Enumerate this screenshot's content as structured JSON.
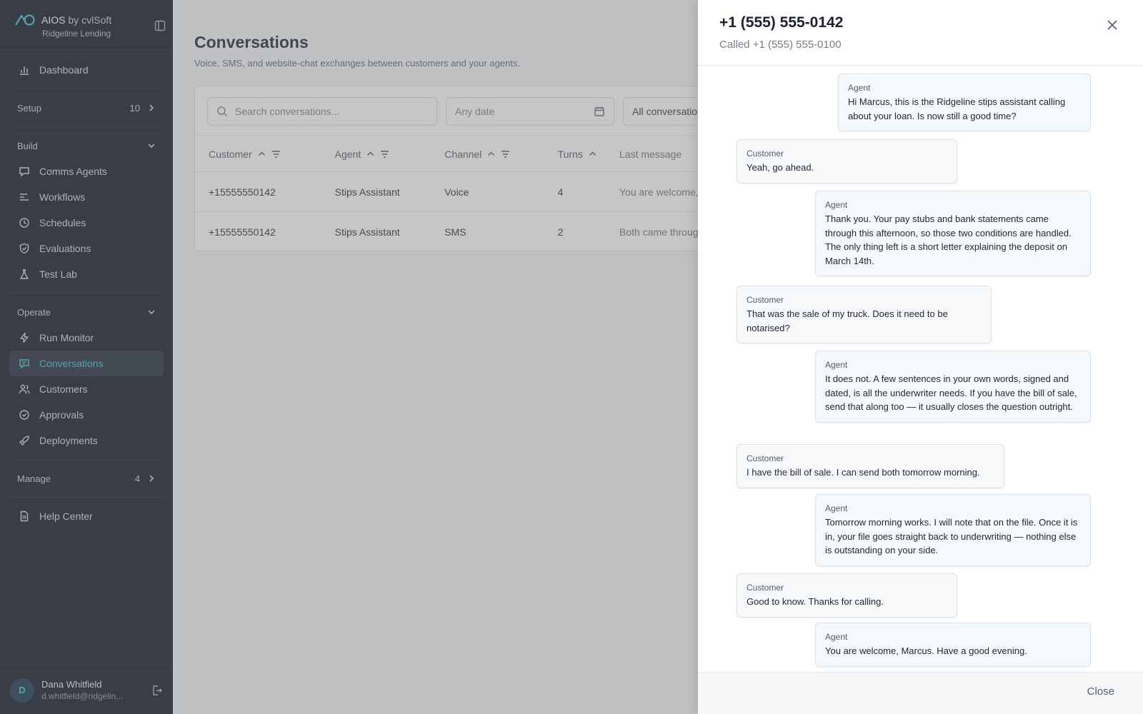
{
  "brand": {
    "name": "AIOS",
    "by": "by cvlSoft",
    "org": "Ridgeline Lending"
  },
  "nav": {
    "dashboard": "Dashboard",
    "setup": {
      "label": "Setup",
      "count": "10"
    },
    "build": {
      "label": "Build",
      "items": [
        "Comms Agents",
        "Workflows",
        "Schedules",
        "Evaluations",
        "Test Lab"
      ]
    },
    "operate": {
      "label": "Operate",
      "items": [
        "Run Monitor",
        "Conversations",
        "Customers",
        "Approvals",
        "Deployments"
      ]
    },
    "manage": {
      "label": "Manage",
      "count": "4"
    },
    "help": "Help Center"
  },
  "user": {
    "initial": "D",
    "name": "Dana Whitfield",
    "email": "d.whitfield@ridgelin..."
  },
  "page": {
    "title": "Conversations",
    "subtitle": "Voice, SMS, and website-chat exchanges between customers and your agents.",
    "search_placeholder": "Search conversations...",
    "date_placeholder": "Any date",
    "filter_value": "All conversations",
    "columns": [
      "Customer",
      "Agent",
      "Channel",
      "Turns",
      "Last message"
    ],
    "rows": [
      [
        "+15555550142",
        "Stips Assistant",
        "Voice",
        "4",
        "You are welcome, Marcus."
      ],
      [
        "+15555550142",
        "Stips Assistant",
        "SMS",
        "2",
        "Both came through."
      ]
    ]
  },
  "drawer": {
    "title": "+1 (555) 555-0142",
    "subtitle": "Called +1 (555) 555-0100",
    "close_label": "Close",
    "messages": [
      {
        "role": "Agent",
        "text": "Hi Marcus, this is the Ridgeline stips assistant calling about your loan. Is now still a good time?"
      },
      {
        "role": "Customer",
        "text": "Yeah, go ahead."
      },
      {
        "role": "Agent",
        "text": "Thank you. Your pay stubs and bank statements came through this afternoon, so those two conditions are handled. The only thing left is a short letter explaining the deposit on March 14th."
      },
      {
        "role": "Customer",
        "text": "That was the sale of my truck. Does it need to be notarised?"
      },
      {
        "role": "Agent",
        "text": "It does not. A few sentences in your own words, signed and dated, is all the underwriter needs. If you have the bill of sale, send that along too — it usually closes the question outright."
      },
      {
        "role": "Customer",
        "text": "I have the bill of sale. I can send both tomorrow morning."
      },
      {
        "role": "Agent",
        "text": "Tomorrow morning works. I will note that on the file. Once it is in, your file goes straight back to underwriting — nothing else is outstanding on your side."
      },
      {
        "role": "Customer",
        "text": "Good to know. Thanks for calling."
      },
      {
        "role": "Agent",
        "text": "You are welcome, Marcus. Have a good evening."
      }
    ]
  },
  "colors": {
    "sidebar": "#0b1423",
    "accent": "#3fc2d6",
    "agent_bubble": "#f4f9fd"
  }
}
